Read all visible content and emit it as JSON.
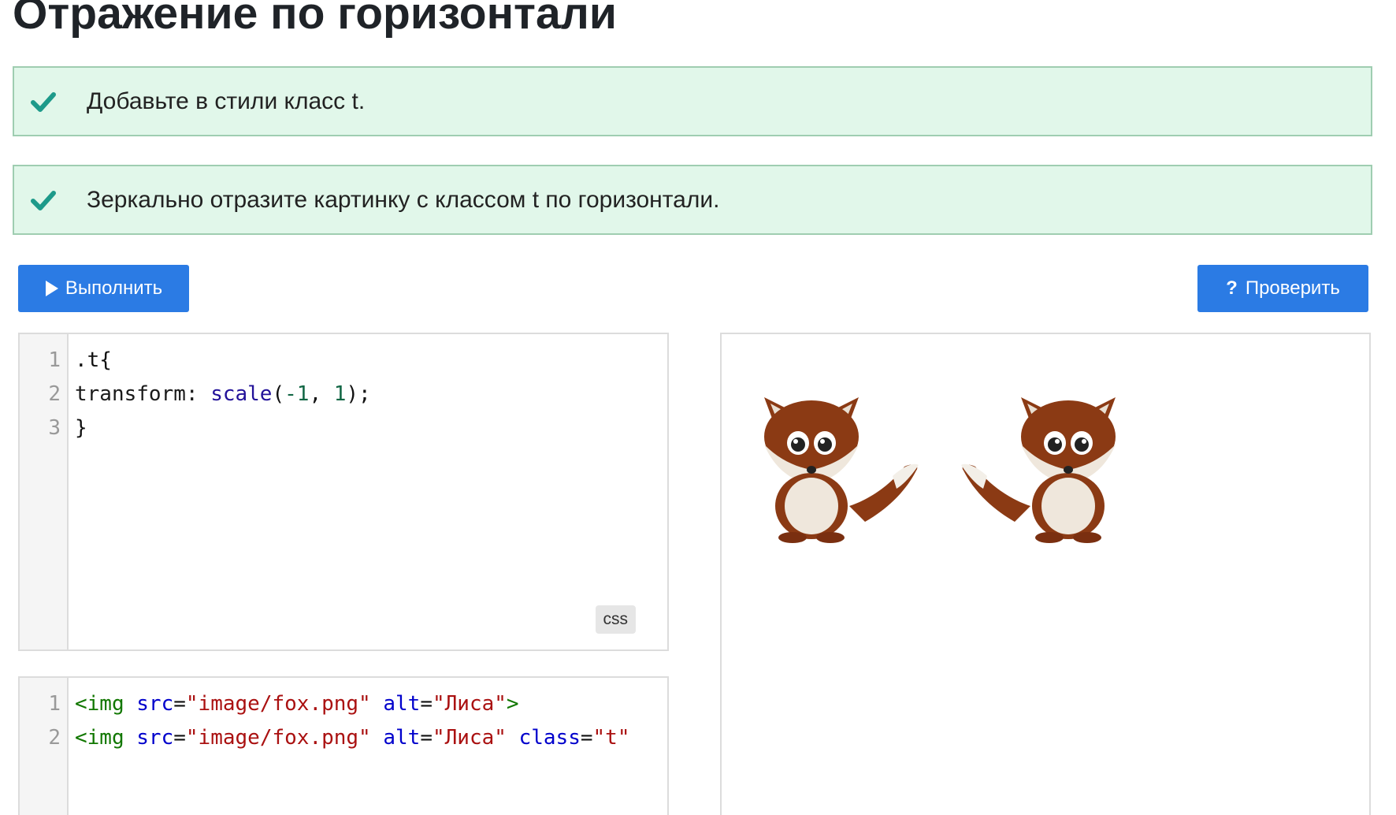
{
  "title": "Отражение по горизонтали",
  "tasks": [
    {
      "text": "Добавьте в стили класс t.",
      "done": true
    },
    {
      "text": "Зеркально отразите картинку с классом t по горизонтали.",
      "done": true
    }
  ],
  "buttons": {
    "run": {
      "label": "Выполнить",
      "icon": "play-icon"
    },
    "check": {
      "label": "Проверить",
      "icon": "question-icon",
      "prefix": "?"
    }
  },
  "css_editor": {
    "language": "css",
    "lines": [
      {
        "n": "1",
        "tokens": [
          {
            "t": ".t{",
            "c": ""
          }
        ]
      },
      {
        "n": "2",
        "tokens": [
          {
            "t": "transform: ",
            "c": "kw-prop"
          },
          {
            "t": "scale",
            "c": "kw-fn"
          },
          {
            "t": "(",
            "c": ""
          },
          {
            "t": "-1",
            "c": "kw-num"
          },
          {
            "t": ", ",
            "c": ""
          },
          {
            "t": "1",
            "c": "kw-num"
          },
          {
            "t": ");",
            "c": ""
          }
        ]
      },
      {
        "n": "3",
        "tokens": [
          {
            "t": "}",
            "c": ""
          }
        ]
      }
    ]
  },
  "html_editor": {
    "lines": [
      {
        "n": "1",
        "tokens": [
          {
            "t": "<img ",
            "c": "tag"
          },
          {
            "t": "src",
            "c": "attr"
          },
          {
            "t": "=",
            "c": ""
          },
          {
            "t": "\"image/fox.png\"",
            "c": "str"
          },
          {
            "t": " ",
            "c": ""
          },
          {
            "t": "alt",
            "c": "attr"
          },
          {
            "t": "=",
            "c": ""
          },
          {
            "t": "\"Лиса\"",
            "c": "str"
          },
          {
            "t": ">",
            "c": "tag"
          }
        ]
      },
      {
        "n": "2",
        "tokens": [
          {
            "t": "<img ",
            "c": "tag"
          },
          {
            "t": "src",
            "c": "attr"
          },
          {
            "t": "=",
            "c": ""
          },
          {
            "t": "\"image/fox.png\"",
            "c": "str"
          },
          {
            "t": " ",
            "c": ""
          },
          {
            "t": "alt",
            "c": "attr"
          },
          {
            "t": "=",
            "c": ""
          },
          {
            "t": "\"Лиса\"",
            "c": "str"
          },
          {
            "t": " ",
            "c": ""
          },
          {
            "t": "class",
            "c": "attr"
          },
          {
            "t": "=",
            "c": ""
          },
          {
            "t": "\"t\"",
            "c": "str"
          }
        ]
      }
    ]
  },
  "preview": {
    "images": [
      {
        "alt": "Лиса",
        "mirrored": false
      },
      {
        "alt": "Лиса",
        "mirrored": true
      }
    ]
  },
  "colors": {
    "accent": "#2b7be4",
    "task_bg": "#e1f7ea",
    "check": "#1d9a8a"
  }
}
